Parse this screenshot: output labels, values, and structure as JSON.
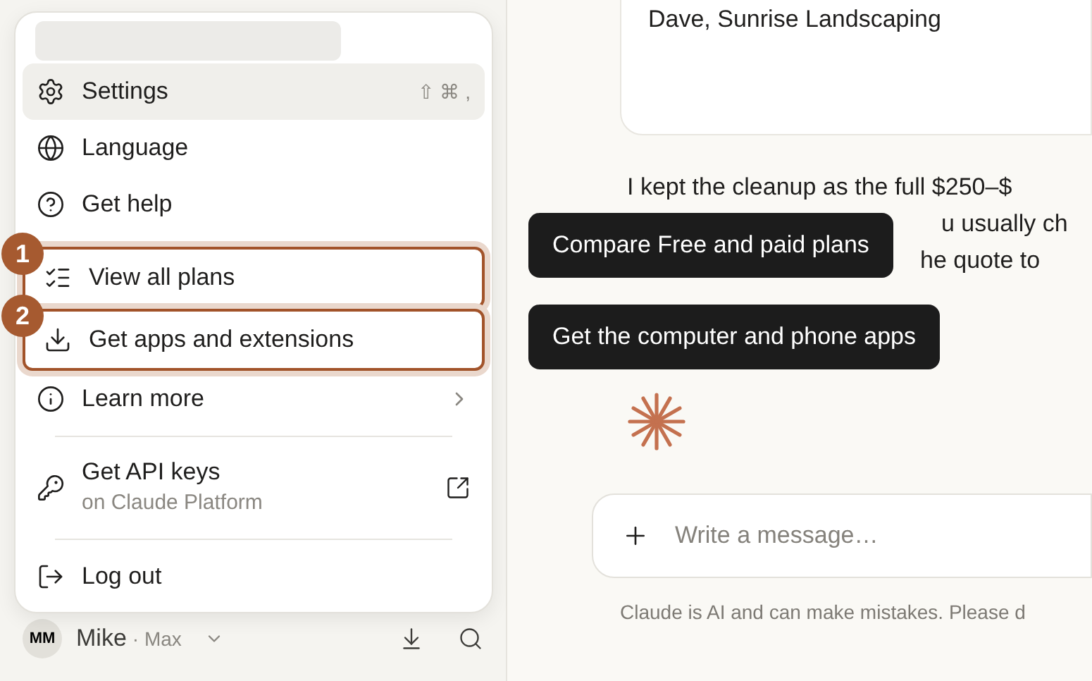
{
  "menu": {
    "items": [
      {
        "kind": "item",
        "label": "Settings",
        "shortcut": "⇧ ⌘ ,",
        "selected": true,
        "highlighted": false
      },
      {
        "kind": "item",
        "label": "Language",
        "selected": false,
        "highlighted": false
      },
      {
        "kind": "item",
        "label": "Get help",
        "selected": false,
        "highlighted": false
      },
      {
        "kind": "item",
        "label": "View all plans",
        "selected": false,
        "highlighted": true,
        "callout": "1"
      },
      {
        "kind": "item",
        "label": "Get apps and extensions",
        "selected": false,
        "highlighted": true,
        "callout": "2"
      },
      {
        "kind": "submenu",
        "label": "Learn more",
        "selected": false,
        "highlighted": false
      },
      {
        "kind": "divider"
      },
      {
        "kind": "external",
        "label": "Get API keys",
        "subtitle": "on Claude Platform",
        "selected": false,
        "highlighted": false
      },
      {
        "kind": "divider"
      },
      {
        "kind": "item",
        "label": "Log out",
        "selected": false,
        "highlighted": false
      }
    ]
  },
  "account": {
    "initials": "MM",
    "name": "Mike",
    "plan": "· Max"
  },
  "conversation": {
    "card_text": "Dave, Sunrise Landscaping",
    "reply_lines": [
      "I kept the cleanup as the full $250–$",
      "u usually ch",
      "he quote to"
    ]
  },
  "tooltips": [
    "Compare Free and paid plans",
    "Get the computer and phone apps"
  ],
  "composer": {
    "placeholder": "Write a message…"
  },
  "disclaimer": "Claude is AI and can make mistakes. Please d"
}
